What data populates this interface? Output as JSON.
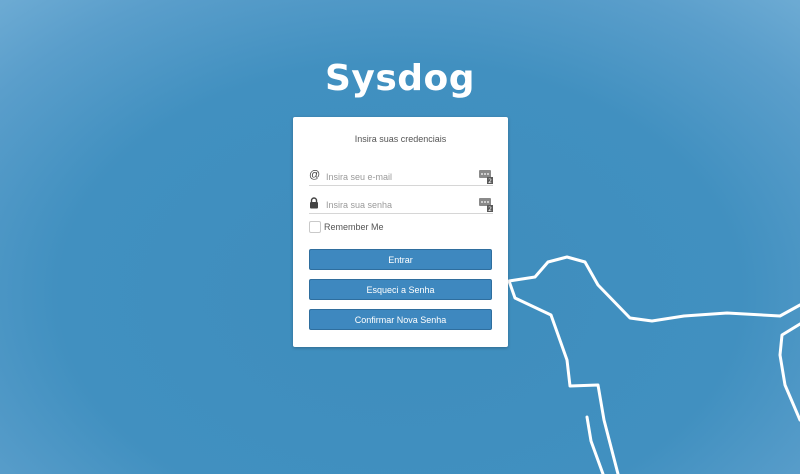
{
  "app": {
    "title": "Sysdog"
  },
  "login": {
    "heading": "Insira suas credenciais",
    "email": {
      "value": "",
      "placeholder": "Insira seu e-mail",
      "icon": "at-sign-icon"
    },
    "password": {
      "value": "",
      "placeholder": "Insira sua senha",
      "icon": "lock-icon"
    },
    "password_manager_icon": "password-manager-icon",
    "remember": {
      "label": "Remember Me",
      "checked": false
    },
    "buttons": {
      "login": "Entrar",
      "forgot": "Esqueci a Senha",
      "confirm": "Confirmar Nova Senha"
    }
  },
  "colors": {
    "background": "#4190c0",
    "button": "#3e88bf",
    "card": "#ffffff",
    "dog_outline": "#ffffff"
  }
}
